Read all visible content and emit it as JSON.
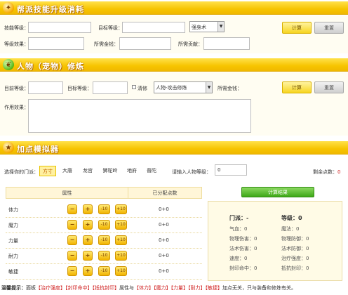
{
  "section1": {
    "title": "帮派技能升级消耗",
    "skill_level_label": "技能等级：",
    "target_level_label": "目标等级：",
    "skill_select": "强身术",
    "calc_label": "计算",
    "reset_label": "重置",
    "level_effect_label": "等级效果：",
    "money_label": "所需金钱：",
    "contrib_label": "所需贡献："
  },
  "section2": {
    "title": "人物（宠物）修炼",
    "current_level_label": "目前等级：",
    "target_level_label": "目标等级：",
    "clear_label": "清修",
    "cultivation_select": "人物-攻击修炼",
    "money_label": "所需金钱：",
    "calc_label": "计算",
    "reset_label": "重置",
    "effect_label": "作用效果："
  },
  "section3": {
    "title": "加点模拟器",
    "school_label": "选择你的门派：",
    "schools": [
      "方寸",
      "大唐",
      "龙宫",
      "狮驼岭",
      "地府",
      "普陀"
    ],
    "level_label": "请输入人物等级：",
    "level_value": "0",
    "remaining_label": "剩余点数：",
    "remaining_value": "0",
    "col_attr": "属性",
    "col_alloc": "已分配点数",
    "save_label": "计算结果",
    "attributes": [
      {
        "name": "体力",
        "value": "0+0"
      },
      {
        "name": "魔力",
        "value": "0+0"
      },
      {
        "name": "力量",
        "value": "0+0"
      },
      {
        "name": "耐力",
        "value": "0+0"
      },
      {
        "name": "敏捷",
        "value": "0+0"
      }
    ],
    "btn_minus": "−",
    "btn_plus": "+",
    "btn_minus10": "-10",
    "btn_plus10": "+10",
    "stats": {
      "school_label": "门派：",
      "school_value": "-",
      "level_label": "等级：",
      "level_value": "0",
      "rows": [
        [
          "气血：0",
          "魔法：0"
        ],
        [
          "物理伤害：0",
          "物理防御：0"
        ],
        [
          "法术伤害：0",
          "法术防御：0"
        ],
        [
          "速度：0",
          "治疗强度：0"
        ],
        [
          "封印命中：0",
          "抵抗封印：0"
        ]
      ]
    }
  },
  "tips": {
    "label": "温馨提示：",
    "p1": "面板",
    "r1": "【治疗强度】【封印命中】【抵抗封印】",
    "p2": "属性与",
    "r2": "【体力】【魔力】【力量】【耐力】【敏捷】",
    "p3": "加点无关，只与装备和修炼有关。"
  },
  "colors": {
    "accent": "#f7c400",
    "panel": "#fffdf2",
    "save": "#3ea818"
  }
}
